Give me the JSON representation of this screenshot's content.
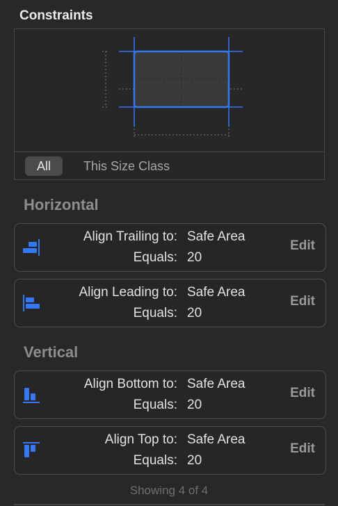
{
  "panel": {
    "title": "Constraints"
  },
  "size_class": {
    "all_label": "All",
    "this_size_label": "This Size Class"
  },
  "groups": [
    {
      "title": "Horizontal",
      "constraints": [
        {
          "relation_label": "Align Trailing to:",
          "target": "Safe Area",
          "equals_label": "Equals:",
          "value": "20",
          "edit_label": "Edit",
          "icon": "align-trailing-icon"
        },
        {
          "relation_label": "Align Leading to:",
          "target": "Safe Area",
          "equals_label": "Equals:",
          "value": "20",
          "edit_label": "Edit",
          "icon": "align-leading-icon"
        }
      ]
    },
    {
      "title": "Vertical",
      "constraints": [
        {
          "relation_label": "Align Bottom to:",
          "target": "Safe Area",
          "equals_label": "Equals:",
          "value": "20",
          "edit_label": "Edit",
          "icon": "align-bottom-icon"
        },
        {
          "relation_label": "Align Top to:",
          "target": "Safe Area",
          "equals_label": "Equals:",
          "value": "20",
          "edit_label": "Edit",
          "icon": "align-top-icon"
        }
      ]
    }
  ],
  "footer": {
    "status": "Showing 4 of 4"
  },
  "colors": {
    "accent": "#3478f6",
    "background": "#282828",
    "card_border": "#4f4f4f"
  }
}
